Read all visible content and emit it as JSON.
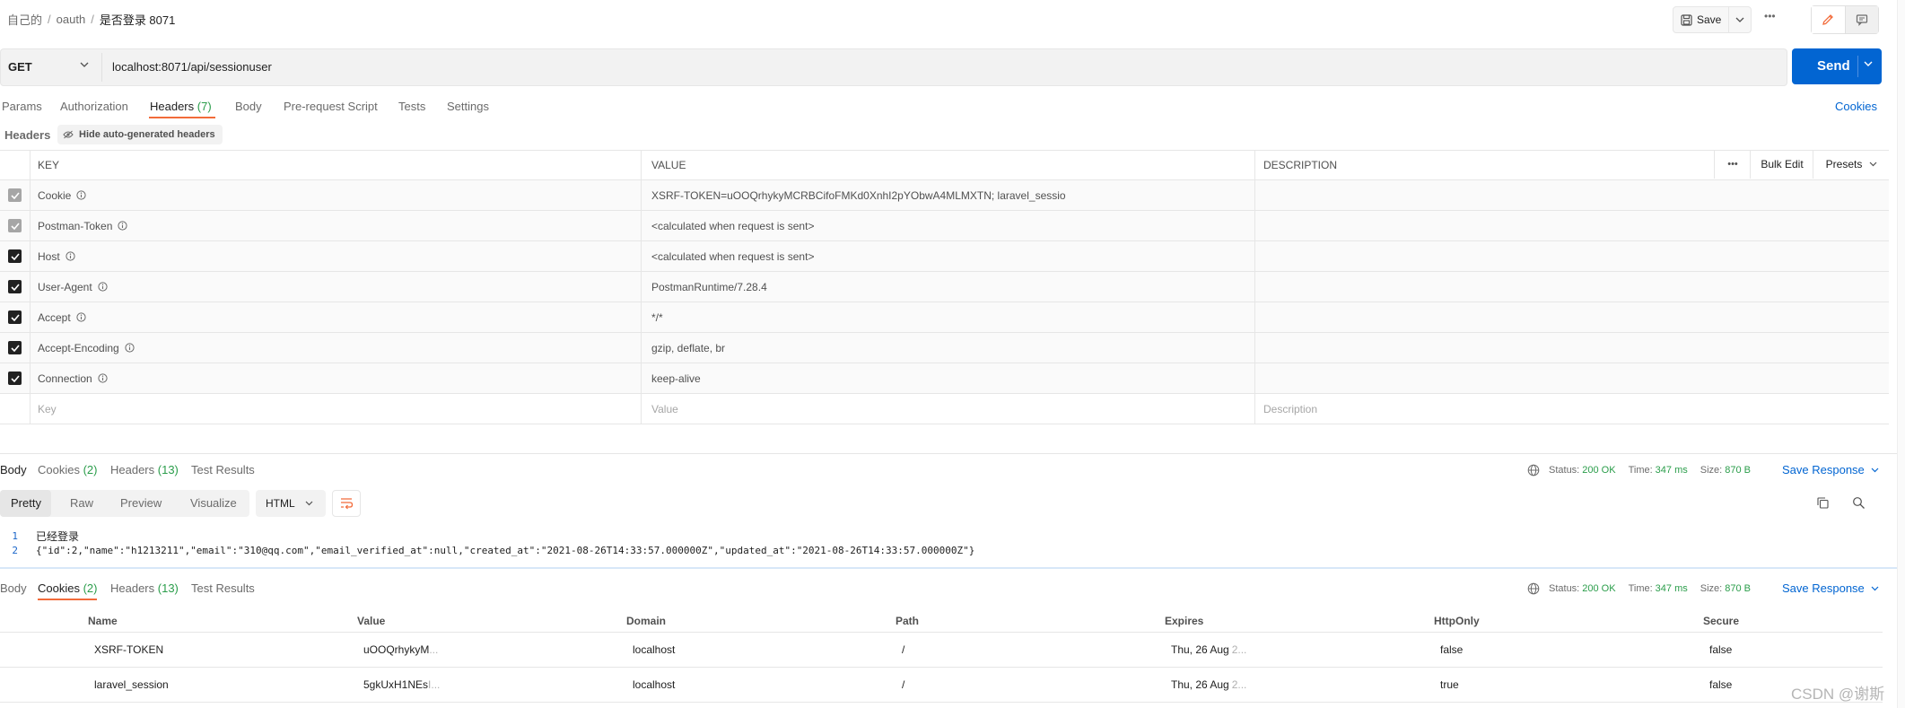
{
  "breadcrumb": {
    "items": [
      "自己的",
      "oauth"
    ],
    "current": "是否登录 8071"
  },
  "toolbar": {
    "save_label": "Save",
    "more_label": "•••"
  },
  "request": {
    "method": "GET",
    "url": "localhost:8071/api/sessionuser",
    "send_label": "Send"
  },
  "request_tabs": {
    "params": "Params",
    "authorization": "Authorization",
    "headers": "Headers",
    "headers_count": "(7)",
    "body": "Body",
    "prerequest": "Pre-request Script",
    "tests": "Tests",
    "settings": "Settings",
    "cookies_link": "Cookies"
  },
  "headers_section": {
    "label": "Headers",
    "hide_auto": "Hide auto-generated headers",
    "columns": {
      "key": "KEY",
      "value": "VALUE",
      "description": "DESCRIPTION"
    },
    "more_label": "•••",
    "bulk_edit": "Bulk Edit",
    "presets": "Presets",
    "rows": [
      {
        "key": "Cookie",
        "value": "XSRF-TOKEN=uOOQrhykyMCRBCifoFMKd0XnhI2pYObwA4MLMXTN; laravel_sessio"
      },
      {
        "key": "Postman-Token",
        "value": "<calculated when request is sent>"
      },
      {
        "key": "Host",
        "value": "<calculated when request is sent>"
      },
      {
        "key": "User-Agent",
        "value": "PostmanRuntime/7.28.4"
      },
      {
        "key": "Accept",
        "value": "*/*"
      },
      {
        "key": "Accept-Encoding",
        "value": "gzip, deflate, br"
      },
      {
        "key": "Connection",
        "value": "keep-alive"
      }
    ],
    "placeholders": {
      "key": "Key",
      "value": "Value",
      "description": "Description"
    }
  },
  "response": {
    "tabs": {
      "body": "Body",
      "cookies": "Cookies",
      "cookies_count": "(2)",
      "headers": "Headers",
      "headers_count": "(13)",
      "test_results": "Test Results"
    },
    "status_label": "Status:",
    "status_value": "200 OK",
    "time_label": "Time:",
    "time_value": "347 ms",
    "size_label": "Size:",
    "size_value": "870 B",
    "save_response": "Save Response",
    "formats": {
      "pretty": "Pretty",
      "raw": "Raw",
      "preview": "Preview",
      "visualize": "Visualize"
    },
    "language": "HTML",
    "lines": [
      {
        "n": "1",
        "text": "已经登录"
      },
      {
        "n": "2",
        "text": "{\"id\":2,\"name\":\"h1213211\",\"email\":\"310@qq.com\",\"email_verified_at\":null,\"created_at\":\"2021-08-26T14:33:57.000000Z\",\"updated_at\":\"2021-08-26T14:33:57.000000Z\"}"
      }
    ]
  },
  "cookies_table": {
    "columns": {
      "name": "Name",
      "value": "Value",
      "domain": "Domain",
      "path": "Path",
      "expires": "Expires",
      "httponly": "HttpOnly",
      "secure": "Secure"
    },
    "rows": [
      {
        "name": "XSRF-TOKEN",
        "value": "uOOQrhykyM",
        "value_fade": "...",
        "domain": "localhost",
        "path": "/",
        "expires": "Thu, 26 Aug",
        "expires_fade": "2...",
        "httponly": "false",
        "secure": "false"
      },
      {
        "name": "laravel_session",
        "value": "5gkUxH1NEs",
        "value_fade": "I...",
        "domain": "localhost",
        "path": "/",
        "expires": "Thu, 26 Aug",
        "expires_fade": "2...",
        "httponly": "true",
        "secure": "false"
      }
    ]
  },
  "watermark": "CSDN @谢斯",
  "colors": {
    "accent": "#0265d2",
    "tab_underline": "#f26b3a",
    "count": "#2a9d4a"
  }
}
